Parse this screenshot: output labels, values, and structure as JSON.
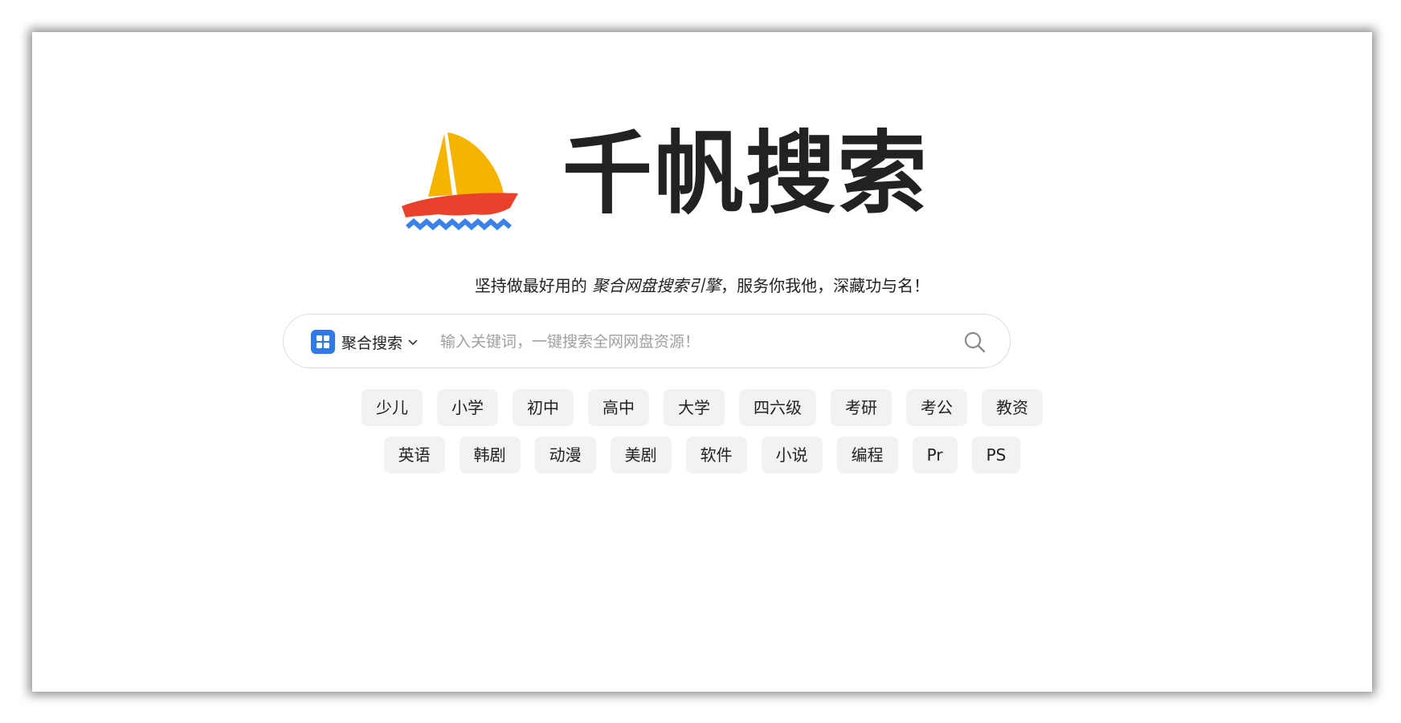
{
  "brand": {
    "title": "千帆搜索",
    "logo_icon": "sailboat-logo-icon",
    "colors": {
      "sail": "#f5b400",
      "hull": "#e8412c",
      "waves": "#3b82e8"
    }
  },
  "slogan": {
    "before": "坚持做最好用的 ",
    "highlight": "聚合网盘搜索引擎",
    "after": "，服务你我他，深藏功与名！"
  },
  "search": {
    "engine_label": "聚合搜索",
    "engine_icon": "grid-apps-icon",
    "placeholder": "输入关键词，一键搜索全网网盘资源！",
    "value": "",
    "button_icon": "search-icon",
    "accent": "#2f7ae5"
  },
  "tags": {
    "row1": [
      "少儿",
      "小学",
      "初中",
      "高中",
      "大学",
      "四六级",
      "考研",
      "考公",
      "教资"
    ],
    "row2": [
      "英语",
      "韩剧",
      "动漫",
      "美剧",
      "软件",
      "小说",
      "编程",
      "Pr",
      "PS"
    ]
  }
}
